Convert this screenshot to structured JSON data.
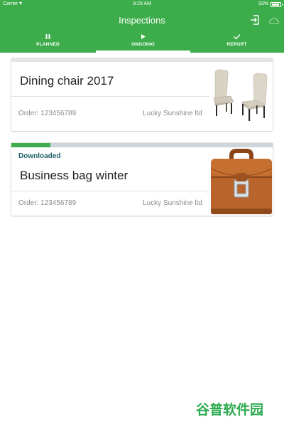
{
  "status_bar": {
    "carrier": "Carrier",
    "time": "9:29 AM",
    "battery": "93%",
    "battery_level": 0.93
  },
  "app_bar": {
    "title": "Inspections"
  },
  "tabs": [
    {
      "label": "PLANNED",
      "icon": "pause-icon"
    },
    {
      "label": "ONGOING",
      "icon": "play-icon",
      "active": true
    },
    {
      "label": "REPORT",
      "icon": "check-icon"
    }
  ],
  "inspections": [
    {
      "title": "Dining chair 2017",
      "order": "Order: 123456789",
      "company": "Lucky Sunshine ltd",
      "image": "chairs-image"
    },
    {
      "status": "Downloaded",
      "title": "Business bag winter",
      "order": "Order: 123456789",
      "company": "Lucky Sunshine ltd",
      "image": "briefcase-image",
      "progress": 0.15
    }
  ],
  "watermark": "谷普软件园",
  "colors": {
    "primary": "#3cad4a",
    "status_text": "#1f5f6a",
    "progress_track": "#cdd5d9"
  }
}
